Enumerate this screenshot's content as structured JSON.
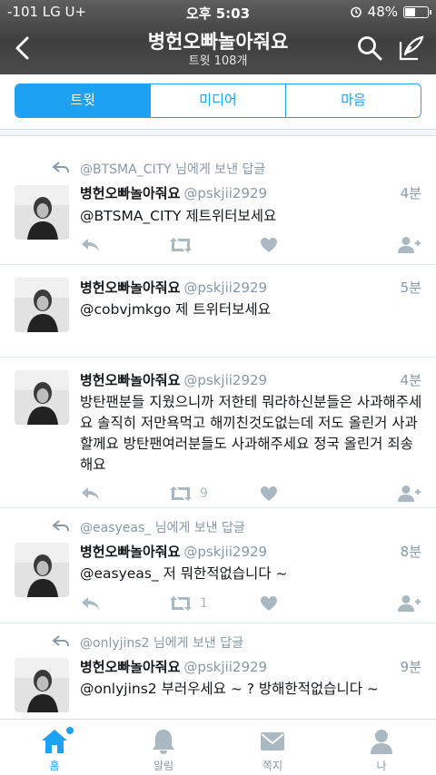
{
  "status": {
    "carrier": "-101 LG U+",
    "time": "오후 5:03",
    "battery": "48%",
    "battery_level": 0.48
  },
  "nav": {
    "title": "병헌오빠놀아줘요",
    "subtitle": "트윗 108개"
  },
  "tabs": [
    {
      "label": "트윗",
      "active": true
    },
    {
      "label": "미디어"
    },
    {
      "label": "마음"
    }
  ],
  "tweets": [
    {
      "reply_to": "@BTSMA_CITY 님에게 보낸 답글",
      "name": "병헌오빠놀아줘요",
      "handle": "@pskjii2929",
      "ago": "4분",
      "text": "@BTSMA_CITY 제트위터보세요",
      "retweets": "",
      "likes": ""
    },
    {
      "reply_to": "",
      "name": "병헌오빠놀아줘요",
      "handle": "@pskjii2929",
      "ago": "5분",
      "text": "@cobvjmkgo 제 트위터보세요",
      "retweets": "",
      "likes": ""
    },
    {
      "reply_to": "",
      "name": "병헌오빠놀아줘요",
      "handle": "@pskjii2929",
      "ago": "4분",
      "text": "방탄팬분들 지웠으니까 저한테 뭐라하신분들은 사과해주세요 솔직히 저만욕먹고 해끼친것도없는데 저도 올린거 사과할께요 방탄팬여러분들도 사과해주세요 정국 올린거 죄송해요",
      "retweets": "9",
      "likes": ""
    },
    {
      "reply_to": "@easyeas_ 님에게 보낸 답글",
      "name": "병헌오빠놀아줘요",
      "handle": "@pskjii2929",
      "ago": "8분",
      "text": "@easyeas_ 저 뭐한적없습니다 ~",
      "retweets": "1",
      "likes": ""
    },
    {
      "reply_to": "@onlyjins2 님에게 보낸 답글",
      "name": "병헌오빠놀아줘요",
      "handle": "@pskjii2929",
      "ago": "9분",
      "text": "@onlyjins2 부러우세요 ~ ? 방해한적없습니다 ~",
      "retweets": "",
      "likes": ""
    }
  ],
  "bottom_nav": [
    {
      "label": "홈",
      "icon": "home-icon",
      "active": true
    },
    {
      "label": "알림",
      "icon": "bell-icon"
    },
    {
      "label": "쪽지",
      "icon": "envelope-icon"
    },
    {
      "label": "나",
      "icon": "person-icon"
    }
  ],
  "colors": {
    "accent": "#1da1f2",
    "muted": "#8899a6",
    "header": "#4a4a4a"
  }
}
